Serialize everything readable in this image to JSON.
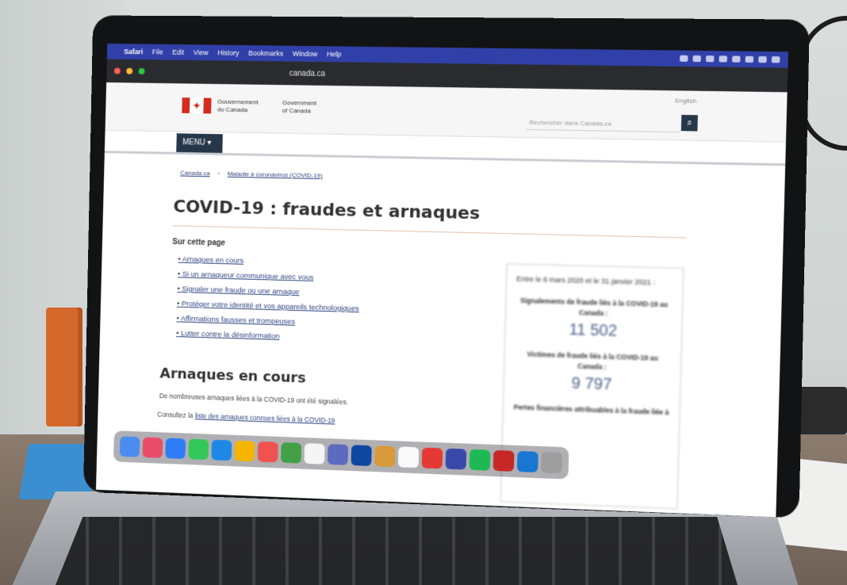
{
  "scene": {
    "description_free": true
  },
  "menubar": {
    "items": [
      "Safari",
      "File",
      "Edit",
      "View",
      "History",
      "Bookmarks",
      "Window",
      "Help"
    ]
  },
  "browser": {
    "address": "canada.ca"
  },
  "gov_header": {
    "name_fr": [
      "Gouvernement",
      "du Canada"
    ],
    "name_en": [
      "Government",
      "of Canada"
    ],
    "language_link": "English",
    "search_placeholder": "Rechercher dans Canada.ca",
    "search_icon": "search-icon"
  },
  "menu_label": "MENU ▾",
  "breadcrumb": [
    "Canada.ca",
    "Maladie à coronavirus (COVID-19)"
  ],
  "page_title": "COVID-19 : fraudes et arnaques",
  "toc": {
    "heading": "Sur cette page",
    "items": [
      "Arnaques en cours",
      "Si un arnaqueur communique avec vous",
      "Signaler une fraude ou une arnaque",
      "Protéger votre identité et vos appareils technologiques",
      "Affirmations fausses et trompeuses",
      "Lutter contre la désinformation"
    ]
  },
  "section": {
    "heading": "Arnaques en cours",
    "para1": "De nombreuses arnaques liées à la COVID-19 ont été signalées.",
    "para2_prefix": "Consultez la ",
    "para2_link": "liste des arnaques connues liées à la COVID-19"
  },
  "stats_card": {
    "intro": "Entre le 6 mars 2020 et le 31 janvier 2021 :",
    "stat1_label": "Signalements de fraude liés à la COVID-19 au Canada :",
    "stat1_value": "11 502",
    "stat2_label": "Victimes de fraude liés à la COVID-19 au Canada :",
    "stat2_value": "9 797",
    "stat3_label": "Pertes financières attribuables à la fraude liée à"
  },
  "colors": {
    "gov_navy": "#26374a",
    "canada_red": "#d52b1e",
    "link_blue": "#2b4380",
    "menubar_blue": "#3040a8"
  }
}
